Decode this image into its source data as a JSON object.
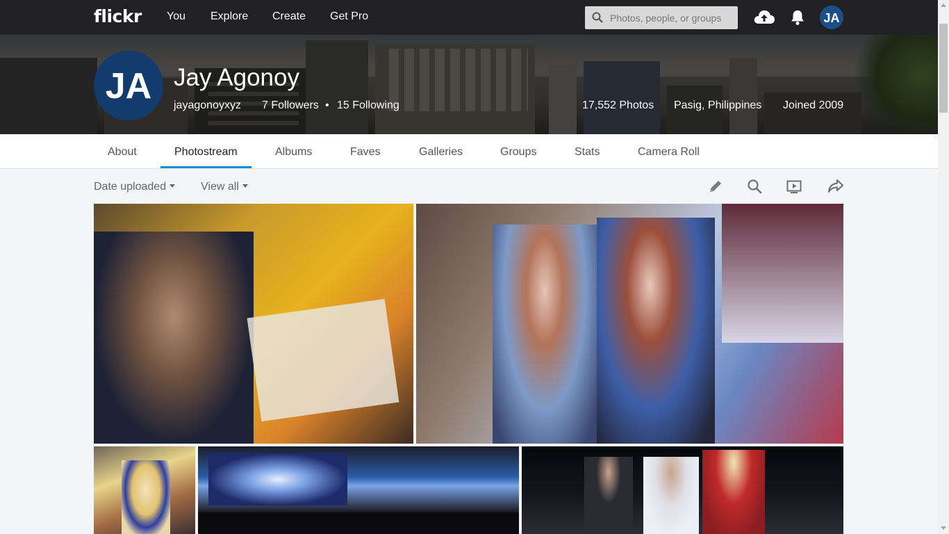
{
  "nav": {
    "logo": "flickr",
    "links": [
      "You",
      "Explore",
      "Create",
      "Get Pro"
    ],
    "search_placeholder": "Photos, people, or groups",
    "avatar_initials": "JA"
  },
  "profile": {
    "name": "Jay Agonoy",
    "username": "jayagonoyxyz",
    "followers": "7 Followers",
    "separator": "•",
    "following": "15 Following",
    "photos": "17,552 Photos",
    "location": "Pasig, Philippines",
    "joined": "Joined 2009",
    "avatar_initials": "JA"
  },
  "tabs": [
    "About",
    "Photostream",
    "Albums",
    "Faves",
    "Galleries",
    "Groups",
    "Stats",
    "Camera Roll"
  ],
  "active_tab": "Photostream",
  "toolbar": {
    "sort": "Date uploaded",
    "view": "View all"
  },
  "colors": {
    "nav_bg": "#212124",
    "accent": "#008ecf",
    "avatar_bg": "#123c6e"
  },
  "icons": [
    "search-icon",
    "upload-cloud-icon",
    "bell-icon",
    "pencil-icon",
    "magnifier-icon",
    "slideshow-icon",
    "share-icon"
  ]
}
